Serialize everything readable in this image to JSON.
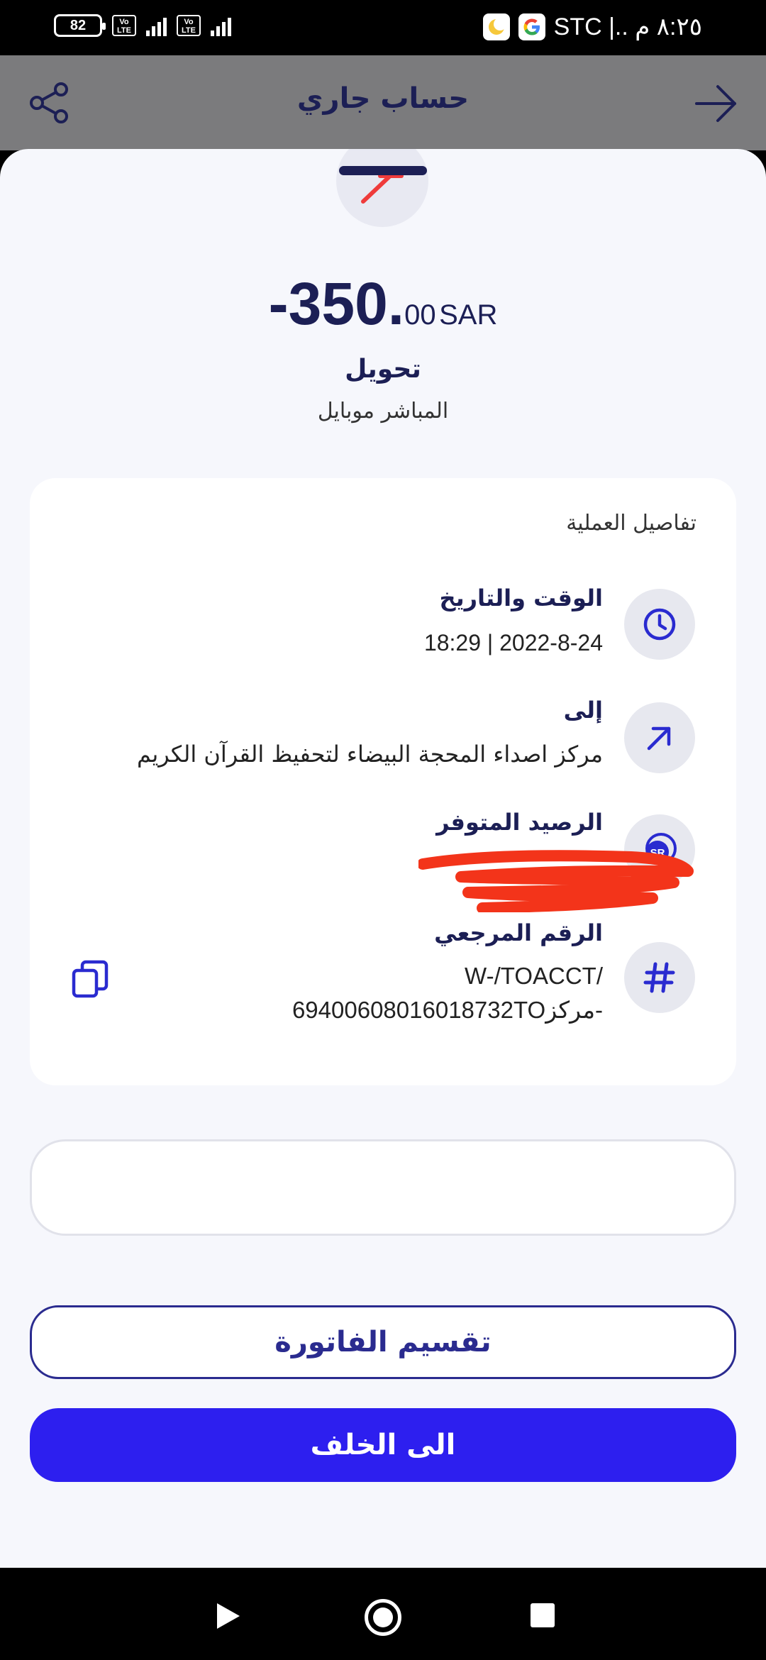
{
  "status_bar": {
    "carrier_time": "STC |.. ٨:٢٥ م",
    "battery": "82",
    "network_type": "4G",
    "volte_label": "Vo LTE"
  },
  "header": {
    "title": "حساب جاري",
    "share_icon": "share-icon",
    "back_icon": "arrow-right-icon"
  },
  "transaction": {
    "amount_main": "-350.",
    "amount_decimals": "00",
    "currency": "SAR",
    "type": "تحويل",
    "channel": "المباشر موبايل"
  },
  "details": {
    "title": "تفاصيل العملية",
    "datetime": {
      "label": "الوقت والتاريخ",
      "value": "18:29   |   2022-8-24",
      "icon": "clock-icon"
    },
    "to": {
      "label": "إلى",
      "value": "مركز اصداء المحجة البيضاء لتحفيظ القرآن الكريم",
      "icon": "arrow-up-right-icon"
    },
    "balance": {
      "label": "الرصيد المتوفر",
      "icon": "sar-coin-icon"
    },
    "reference": {
      "label": "الرقم المرجعي",
      "line1": "W-/TOACCT/",
      "line2": "6940060801601873​2TOمركز-",
      "icon": "hash-icon",
      "copy_icon": "copy-icon"
    }
  },
  "note_input": {
    "value": ""
  },
  "buttons": {
    "split_bill": "تقسيم الفاتورة",
    "back": "الى الخلف"
  },
  "colors": {
    "brand_dark": "#1c1f55",
    "primary": "#2d1fef",
    "accent_red": "#ef3b3b"
  }
}
